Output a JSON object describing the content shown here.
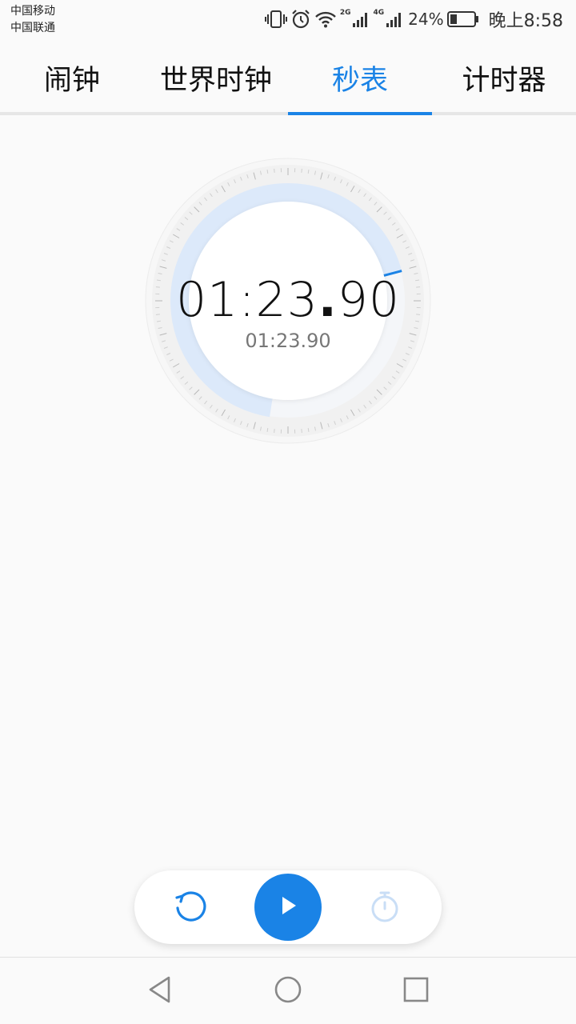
{
  "status_bar": {
    "carrier_1": "中国移动",
    "carrier_2": "中国联通",
    "network_1": "2G",
    "network_2": "4G",
    "battery_percent": "24%",
    "time": "晚上8:58",
    "icons": [
      "vibrate-icon",
      "alarm-icon",
      "wifi-icon",
      "signal-icon",
      "signal-icon",
      "battery-icon"
    ]
  },
  "tabs": [
    {
      "label": "闹钟",
      "active": false
    },
    {
      "label": "世界时钟",
      "active": false
    },
    {
      "label": "秒表",
      "active": true
    },
    {
      "label": "计时器",
      "active": false
    }
  ],
  "stopwatch": {
    "main_min": "01",
    "main_sec": "23",
    "main_centi": "90",
    "sub_time": "01:23.90",
    "progress_fraction": 0.398,
    "accent": "#1a83e6"
  },
  "controls": {
    "reset_icon": "reset-icon",
    "play_icon": "play-icon",
    "lap_icon": "stopwatch-icon"
  },
  "navbar": {
    "icons": [
      "back-icon",
      "home-icon",
      "recents-icon"
    ]
  }
}
